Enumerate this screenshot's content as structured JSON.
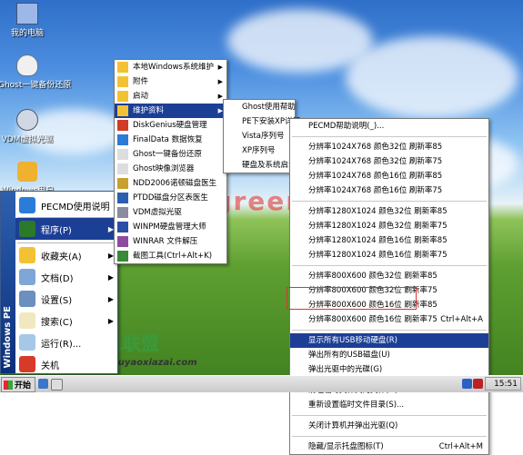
{
  "desktop_icons": [
    {
      "name": "mycomputer",
      "label": "我的电脑",
      "color": "#9db8e8"
    },
    {
      "name": "ghost",
      "label": "Ghost一键备份还原",
      "color": "#f0f0f0"
    },
    {
      "name": "vdm",
      "label": "VDM虚拟光驱",
      "color": "#cfd8e4"
    },
    {
      "name": "winuser",
      "label": "Windows用户",
      "color": "#f0b030"
    }
  ],
  "start_menu": {
    "band_text": "Windows PE",
    "items": [
      {
        "label": "PECMD使用说明",
        "arrow": "",
        "color": "#2b7bd9"
      },
      {
        "label": "程序(P)",
        "arrow": "▶",
        "color": "#2a7a2a",
        "selected": true
      },
      {
        "label": "收藏夹(A)",
        "arrow": "▶",
        "color": "#f3c233"
      },
      {
        "label": "文档(D)",
        "arrow": "▶",
        "color": "#7ea7d8"
      },
      {
        "label": "设置(S)",
        "arrow": "▶",
        "color": "#6b8fbf"
      },
      {
        "label": "搜索(C)",
        "arrow": "▶",
        "color": "#f0e8c0"
      },
      {
        "label": "运行(R)...",
        "arrow": "",
        "color": "#a6c8e8"
      },
      {
        "label": "关机",
        "arrow": "",
        "color": "#d83a2a"
      }
    ]
  },
  "programs_menu": [
    {
      "label": "本地Windows系统维护",
      "arrow": "▶"
    },
    {
      "label": "附件",
      "arrow": "▶"
    },
    {
      "label": "启动",
      "arrow": "▶"
    },
    {
      "label": "维护资料",
      "arrow": "▶",
      "selected": true
    },
    {
      "label": "DiskGenius硬盘管理",
      "arrow": ""
    },
    {
      "label": "FinalData 数据恢复",
      "arrow": ""
    },
    {
      "label": "Ghost一键备份还原",
      "arrow": ""
    },
    {
      "label": "Ghost映像浏览器",
      "arrow": ""
    },
    {
      "label": "NDD2006诺顿磁盘医生",
      "arrow": ""
    },
    {
      "label": "PTDD磁盘分区表医生",
      "arrow": ""
    },
    {
      "label": "VDM虚拟光驱",
      "arrow": ""
    },
    {
      "label": "WINPM硬盘管理大师",
      "arrow": ""
    },
    {
      "label": "WINRAR 文件解压",
      "arrow": ""
    },
    {
      "label": "截图工具(Ctrl+Alt+K)",
      "arrow": ""
    }
  ],
  "maintenance_menu": [
    {
      "label": "Ghost使用帮助"
    },
    {
      "label": "PE下安装XP详解"
    },
    {
      "label": "Vista序列号"
    },
    {
      "label": "XP序列号"
    },
    {
      "label": "硬盘及系统启动"
    }
  ],
  "context_menu": {
    "items": [
      {
        "label": "PECMD帮助说明(_)...",
        "shortcut": ""
      },
      {
        "sep": true
      },
      {
        "label": "分辨率1024X768 颜色32位 刷新率85",
        "shortcut": ""
      },
      {
        "label": "分辨率1024X768 颜色32位 刷新率75",
        "shortcut": ""
      },
      {
        "label": "分辨率1024X768 颜色16位 刷新率85",
        "shortcut": ""
      },
      {
        "label": "分辨率1024X768 颜色16位 刷新率75",
        "shortcut": ""
      },
      {
        "sep": true
      },
      {
        "label": "分辨率1280X1024 颜色32位 刷新率85",
        "shortcut": ""
      },
      {
        "label": "分辨率1280X1024 颜色32位 刷新率75",
        "shortcut": ""
      },
      {
        "label": "分辨率1280X1024 颜色16位 刷新率85",
        "shortcut": ""
      },
      {
        "label": "分辨率1280X1024 颜色16位 刷新率75",
        "shortcut": ""
      },
      {
        "sep": true
      },
      {
        "label": "分辨率800X600 颜色32位 刷新率85",
        "shortcut": ""
      },
      {
        "label": "分辨率800X600 颜色32位 刷新率75",
        "shortcut": ""
      },
      {
        "label": "分辨率800X600 颜色16位 刷新率85",
        "shortcut": ""
      },
      {
        "label": "分辨率800X600 颜色16位 刷新率75",
        "shortcut": "Ctrl+Alt+A"
      },
      {
        "sep": true
      },
      {
        "label": "显示所有USB移动硬盘(R)",
        "shortcut": "",
        "selected": true
      },
      {
        "label": "弹出所有的USB磁盘(U)",
        "shortcut": ""
      },
      {
        "label": "弹出光驱中的光碟(G)",
        "shortcut": ""
      },
      {
        "sep": true
      },
      {
        "label": "清理临时文件夹的文件(D)...",
        "shortcut": ""
      },
      {
        "label": "重新设置临时文件目录(S)...",
        "shortcut": ""
      },
      {
        "sep": true
      },
      {
        "label": "关闭计算机并弹出光驱(Q)",
        "shortcut": ""
      },
      {
        "sep": true
      },
      {
        "label": "隐藏/显示托盘图标(T)",
        "shortcut": "Ctrl+Alt+M"
      }
    ]
  },
  "taskbar": {
    "start_label": "开始",
    "clock": "15:51"
  },
  "watermark": {
    "red_text": "www.greenxf.com",
    "green_text": "绿色联盟",
    "url": "www.ouyaoxiazai.com"
  },
  "colors": {
    "selection": "#1c3f96",
    "highlight_box": "#dd3333"
  }
}
